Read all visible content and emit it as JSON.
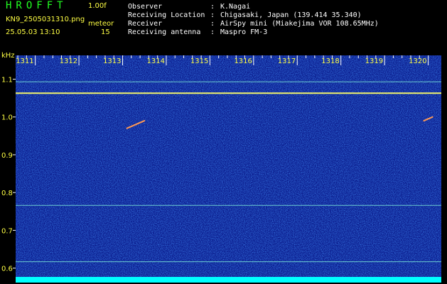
{
  "header": {
    "logo": "HROFFT",
    "version": "1.00f",
    "filename": "KN9_2505031310.png",
    "mode": "meteor",
    "datetime": "25.05.03 13:10",
    "count": "15",
    "info": [
      {
        "key": "Observer",
        "value": "K.Nagai"
      },
      {
        "key": "Receiving Location",
        "value": "Chigasaki, Japan (139.414 35.340)"
      },
      {
        "key": "Receiver",
        "value": "AirSpy mini (Miakejima VOR 108.65MHz)"
      },
      {
        "key": "Receiving antenna",
        "value": "Maspro FM-3"
      }
    ]
  },
  "colors": {
    "background": "#0a1a8c",
    "signal": "#ffff66",
    "tick_text": "#ffff44",
    "baseline": "#00ffff"
  },
  "chart_data": {
    "type": "heatmap",
    "title": "",
    "xlabel": "",
    "ylabel": "kHz",
    "x_ticks": [
      1311,
      1312,
      1313,
      1314,
      1315,
      1316,
      1317,
      1318,
      1319,
      1320
    ],
    "y_ticks": [
      0.6,
      0.7,
      0.8,
      0.9,
      1.0,
      1.1
    ],
    "xlim": [
      1310.55,
      1320.3
    ],
    "ylim": [
      0.573,
      1.163
    ],
    "horizontal_lines_khz": [
      1.093,
      1.063,
      0.766,
      0.617
    ],
    "meteor_echoes": [
      {
        "x_start": 1313.1,
        "y_start": 0.97,
        "x_end": 1313.5,
        "y_end": 0.99
      },
      {
        "x_start": 1319.9,
        "y_start": 0.99,
        "x_end": 1320.1,
        "y_end": 1.0
      }
    ]
  }
}
